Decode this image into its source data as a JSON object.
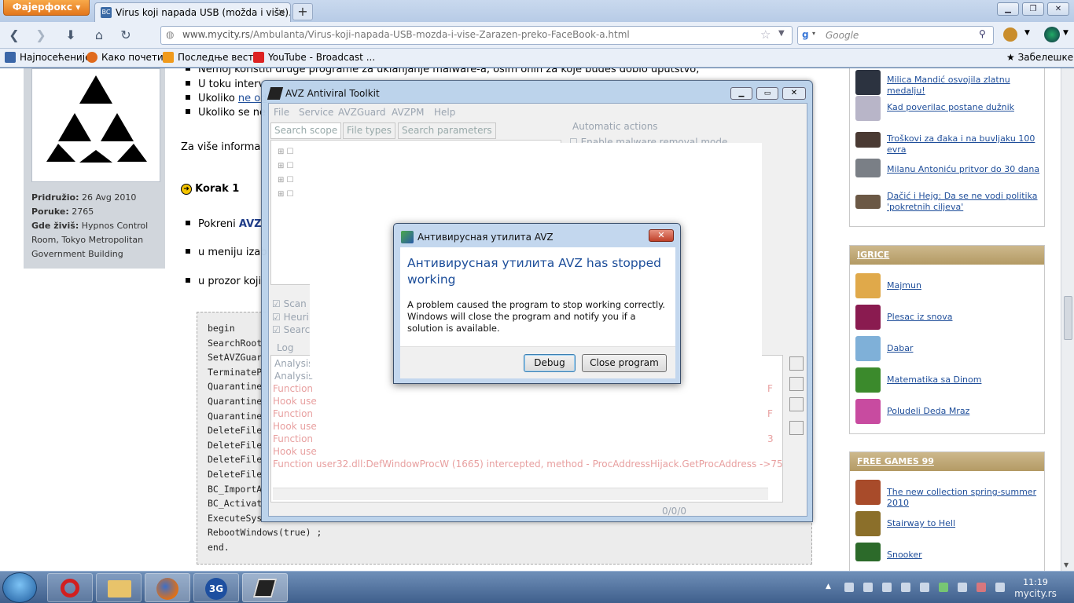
{
  "browser": {
    "firefox_button": "Фајерфокс",
    "tab_title": "Virus koji napada USB (možda i više). Zar...",
    "tab_favicon": "BC",
    "url_domain": "www.mycity.rs",
    "url_path": "/Ambulanta/Virus-koji-napada-USB-mozda-i-vise-Zarazen-preko-FaceBook-a.html",
    "search_placeholder": "Google",
    "bookmarks": [
      "Најпосећеније",
      "Како почети",
      "Последње вести",
      "YouTube - Broadcast ..."
    ],
    "bookmarks_right": "Забелешке"
  },
  "left_panel": {
    "joined_label": "Pridružio:",
    "joined_value": "26 Avg 2010",
    "posts_label": "Poruke:",
    "posts_value": "2765",
    "location_label": "Gde živiš:",
    "location_value": "Hypnos Control Room, Tokyo Metropolitan Government Building"
  },
  "post": {
    "bullets_top": [
      "Nemoj koristiti druge programe za uklanjanje malware-a, osim onih za koje budeš dobio uputstvo;",
      "U toku interv",
      "Ukoliko",
      "Ukoliko se ne"
    ],
    "bullet3_link": "ne od",
    "more_info": "Za više informa",
    "step_title": "Korak 1",
    "steps": [
      "Pokreni",
      "u meniju izab",
      "u prozor koji"
    ],
    "step1_bold": "AVZ",
    "code": [
      "begin",
      "SearchRoot",
      "SetAVZGuar",
      "TerminateP",
      "Quarantine",
      "Quarantine",
      "Quarantine",
      "DeleteFile",
      "DeleteFile",
      "DeleteFile",
      "DeleteFile",
      "BC_ImportA",
      "BC_Activat",
      "ExecuteSys",
      "RebootWindows(true) ;",
      "end."
    ]
  },
  "sidebar": {
    "news": [
      "Milica Mandić osvojila zlatnu medalju!",
      "Kad poverilac postane dužnik",
      "Troškovi za đaka i na buvljaku 100 evra",
      "Milanu Antoniću pritvor do 30 dana",
      "Dačić i Hejg: Da se ne vodi politika 'pokretnih ciljeva'"
    ],
    "igrice_title": "IGRICE",
    "igrice": [
      "Majmun",
      "Plesac iz snova",
      "Dabar",
      "Matematika sa Dinom",
      "Poludeli Deda Mraz"
    ],
    "freegames_title": "FREE GAMES 99",
    "freegames": [
      "The new collection spring-summer 2010",
      "Stairway to Hell",
      "Snooker"
    ]
  },
  "avz": {
    "title": "AVZ Antiviral Toolkit",
    "menu": [
      "File",
      "Service",
      "AVZGuard",
      "AVZPM",
      "Help"
    ],
    "tabs": [
      "Search scope",
      "File types",
      "Search parameters"
    ],
    "automatic_actions": "Automatic actions",
    "enable_malware": "Enable malware removal mode",
    "checks": [
      "Scan",
      "Heuri",
      "Searc"
    ],
    "log_label": "Log",
    "log_lines": [
      "Analysis",
      "Analysis"
    ],
    "red_lines": [
      "Function",
      "Hook use",
      "Function",
      "Hook use",
      "Function",
      "Hook use"
    ],
    "red_right": [
      "F",
      "F",
      "3"
    ],
    "last_line": "Function user32.dll:DefWindowProcW (1665) intercepted, method - ProcAddressHijack.GetProcAddress ->75",
    "status": "0/0/0"
  },
  "dialog": {
    "title": "Антивирусная утилита AVZ",
    "heading": "Антивирусная утилита AVZ has stopped working",
    "message": "A problem caused the program to stop working correctly. Windows will close the program and notify you if a solution is available.",
    "debug_button": "Debug",
    "close_button": "Close program"
  },
  "taskbar": {
    "time": "11:19",
    "watermark": "mycity.rs"
  }
}
